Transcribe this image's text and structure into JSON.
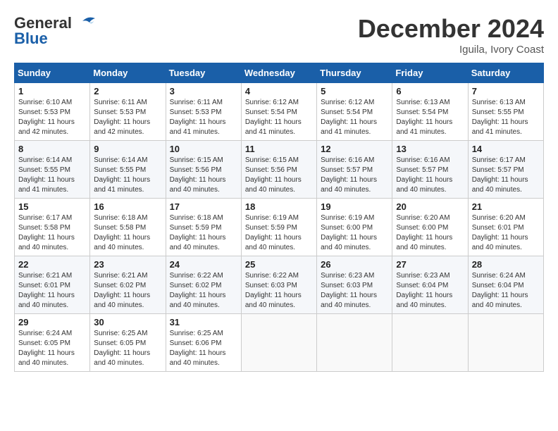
{
  "logo": {
    "line1": "General",
    "line2": "Blue"
  },
  "title": "December 2024",
  "location": "Iguila, Ivory Coast",
  "days_of_week": [
    "Sunday",
    "Monday",
    "Tuesday",
    "Wednesday",
    "Thursday",
    "Friday",
    "Saturday"
  ],
  "weeks": [
    [
      {
        "day": 1,
        "sunrise": "6:10 AM",
        "sunset": "5:53 PM",
        "daylight": "11 hours and 42 minutes."
      },
      {
        "day": 2,
        "sunrise": "6:11 AM",
        "sunset": "5:53 PM",
        "daylight": "11 hours and 42 minutes."
      },
      {
        "day": 3,
        "sunrise": "6:11 AM",
        "sunset": "5:53 PM",
        "daylight": "11 hours and 41 minutes."
      },
      {
        "day": 4,
        "sunrise": "6:12 AM",
        "sunset": "5:54 PM",
        "daylight": "11 hours and 41 minutes."
      },
      {
        "day": 5,
        "sunrise": "6:12 AM",
        "sunset": "5:54 PM",
        "daylight": "11 hours and 41 minutes."
      },
      {
        "day": 6,
        "sunrise": "6:13 AM",
        "sunset": "5:54 PM",
        "daylight": "11 hours and 41 minutes."
      },
      {
        "day": 7,
        "sunrise": "6:13 AM",
        "sunset": "5:55 PM",
        "daylight": "11 hours and 41 minutes."
      }
    ],
    [
      {
        "day": 8,
        "sunrise": "6:14 AM",
        "sunset": "5:55 PM",
        "daylight": "11 hours and 41 minutes."
      },
      {
        "day": 9,
        "sunrise": "6:14 AM",
        "sunset": "5:55 PM",
        "daylight": "11 hours and 41 minutes."
      },
      {
        "day": 10,
        "sunrise": "6:15 AM",
        "sunset": "5:56 PM",
        "daylight": "11 hours and 40 minutes."
      },
      {
        "day": 11,
        "sunrise": "6:15 AM",
        "sunset": "5:56 PM",
        "daylight": "11 hours and 40 minutes."
      },
      {
        "day": 12,
        "sunrise": "6:16 AM",
        "sunset": "5:57 PM",
        "daylight": "11 hours and 40 minutes."
      },
      {
        "day": 13,
        "sunrise": "6:16 AM",
        "sunset": "5:57 PM",
        "daylight": "11 hours and 40 minutes."
      },
      {
        "day": 14,
        "sunrise": "6:17 AM",
        "sunset": "5:57 PM",
        "daylight": "11 hours and 40 minutes."
      }
    ],
    [
      {
        "day": 15,
        "sunrise": "6:17 AM",
        "sunset": "5:58 PM",
        "daylight": "11 hours and 40 minutes."
      },
      {
        "day": 16,
        "sunrise": "6:18 AM",
        "sunset": "5:58 PM",
        "daylight": "11 hours and 40 minutes."
      },
      {
        "day": 17,
        "sunrise": "6:18 AM",
        "sunset": "5:59 PM",
        "daylight": "11 hours and 40 minutes."
      },
      {
        "day": 18,
        "sunrise": "6:19 AM",
        "sunset": "5:59 PM",
        "daylight": "11 hours and 40 minutes."
      },
      {
        "day": 19,
        "sunrise": "6:19 AM",
        "sunset": "6:00 PM",
        "daylight": "11 hours and 40 minutes."
      },
      {
        "day": 20,
        "sunrise": "6:20 AM",
        "sunset": "6:00 PM",
        "daylight": "11 hours and 40 minutes."
      },
      {
        "day": 21,
        "sunrise": "6:20 AM",
        "sunset": "6:01 PM",
        "daylight": "11 hours and 40 minutes."
      }
    ],
    [
      {
        "day": 22,
        "sunrise": "6:21 AM",
        "sunset": "6:01 PM",
        "daylight": "11 hours and 40 minutes."
      },
      {
        "day": 23,
        "sunrise": "6:21 AM",
        "sunset": "6:02 PM",
        "daylight": "11 hours and 40 minutes."
      },
      {
        "day": 24,
        "sunrise": "6:22 AM",
        "sunset": "6:02 PM",
        "daylight": "11 hours and 40 minutes."
      },
      {
        "day": 25,
        "sunrise": "6:22 AM",
        "sunset": "6:03 PM",
        "daylight": "11 hours and 40 minutes."
      },
      {
        "day": 26,
        "sunrise": "6:23 AM",
        "sunset": "6:03 PM",
        "daylight": "11 hours and 40 minutes."
      },
      {
        "day": 27,
        "sunrise": "6:23 AM",
        "sunset": "6:04 PM",
        "daylight": "11 hours and 40 minutes."
      },
      {
        "day": 28,
        "sunrise": "6:24 AM",
        "sunset": "6:04 PM",
        "daylight": "11 hours and 40 minutes."
      }
    ],
    [
      {
        "day": 29,
        "sunrise": "6:24 AM",
        "sunset": "6:05 PM",
        "daylight": "11 hours and 40 minutes."
      },
      {
        "day": 30,
        "sunrise": "6:25 AM",
        "sunset": "6:05 PM",
        "daylight": "11 hours and 40 minutes."
      },
      {
        "day": 31,
        "sunrise": "6:25 AM",
        "sunset": "6:06 PM",
        "daylight": "11 hours and 40 minutes."
      },
      null,
      null,
      null,
      null
    ]
  ]
}
